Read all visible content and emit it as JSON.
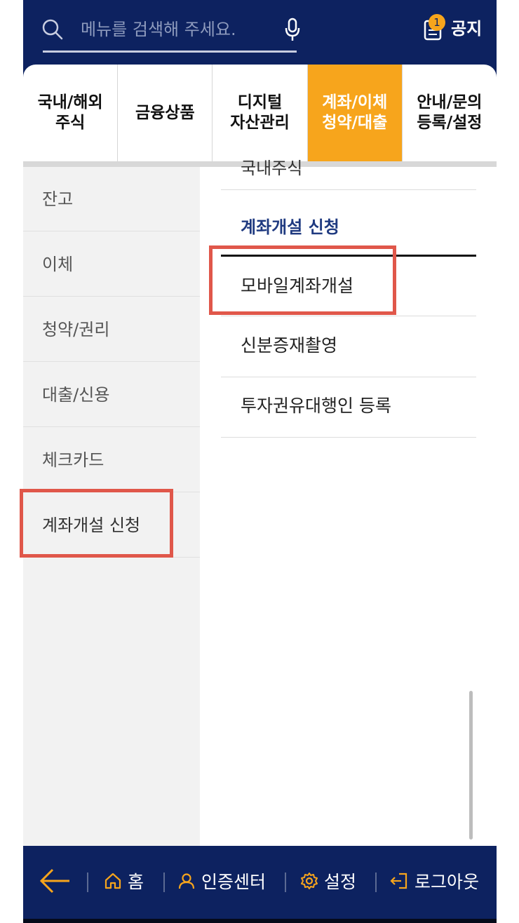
{
  "search": {
    "placeholder": "메뉴를 검색해 주세요."
  },
  "notice": {
    "badge": "1",
    "label": "공지"
  },
  "tabs": [
    {
      "label": "국내/해외\n주식"
    },
    {
      "label": "금융상품"
    },
    {
      "label": "디지털\n자산관리"
    },
    {
      "label": "계좌/이체\n청약/대출"
    },
    {
      "label": "안내/문의\n등록/설정"
    }
  ],
  "left_menu": [
    "잔고",
    "이체",
    "청약/권리",
    "대출/신용",
    "체크카드",
    "계좌개설 신청"
  ],
  "right_panel": {
    "cut_text": "국내주식",
    "section_title": "계좌개설 신청",
    "items": [
      "모바일계좌개설",
      "신분증재촬영",
      "투자권유대행인 등록"
    ]
  },
  "bottom_nav": {
    "home": "홈",
    "auth": "인증센터",
    "settings": "설정",
    "logout": "로그아웃"
  },
  "colors": {
    "navy": "#0d2260",
    "accent": "#f7a51c",
    "highlight": "#e0574a",
    "section_title": "#1f3a80"
  }
}
